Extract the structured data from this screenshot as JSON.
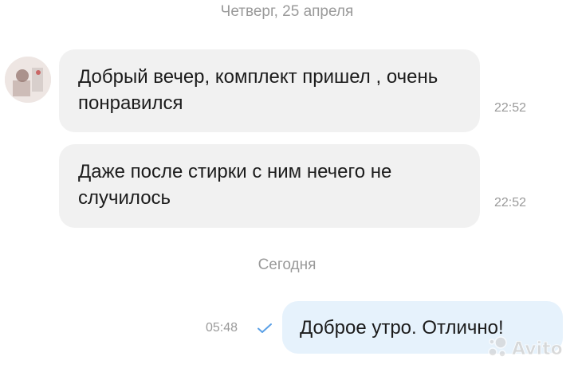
{
  "dates": {
    "previous": "Четверг, 25 апреля",
    "today": "Сегодня"
  },
  "messages": [
    {
      "direction": "incoming",
      "text": "Добрый вечер, комплект пришел , очень понравился",
      "time": "22:52"
    },
    {
      "direction": "incoming",
      "text": "Даже после стирки с ним нечего не случилось",
      "time": "22:52"
    },
    {
      "direction": "outgoing",
      "text": "Доброе утро. Отлично!",
      "time": "05:48",
      "status_icon": "check-icon"
    }
  ],
  "watermark": {
    "text": "Avito"
  },
  "colors": {
    "incoming_bubble": "#f1f1f1",
    "outgoing_bubble": "#e6f2fc",
    "meta_text": "#9a9a9a",
    "check": "#5aa0e6"
  }
}
